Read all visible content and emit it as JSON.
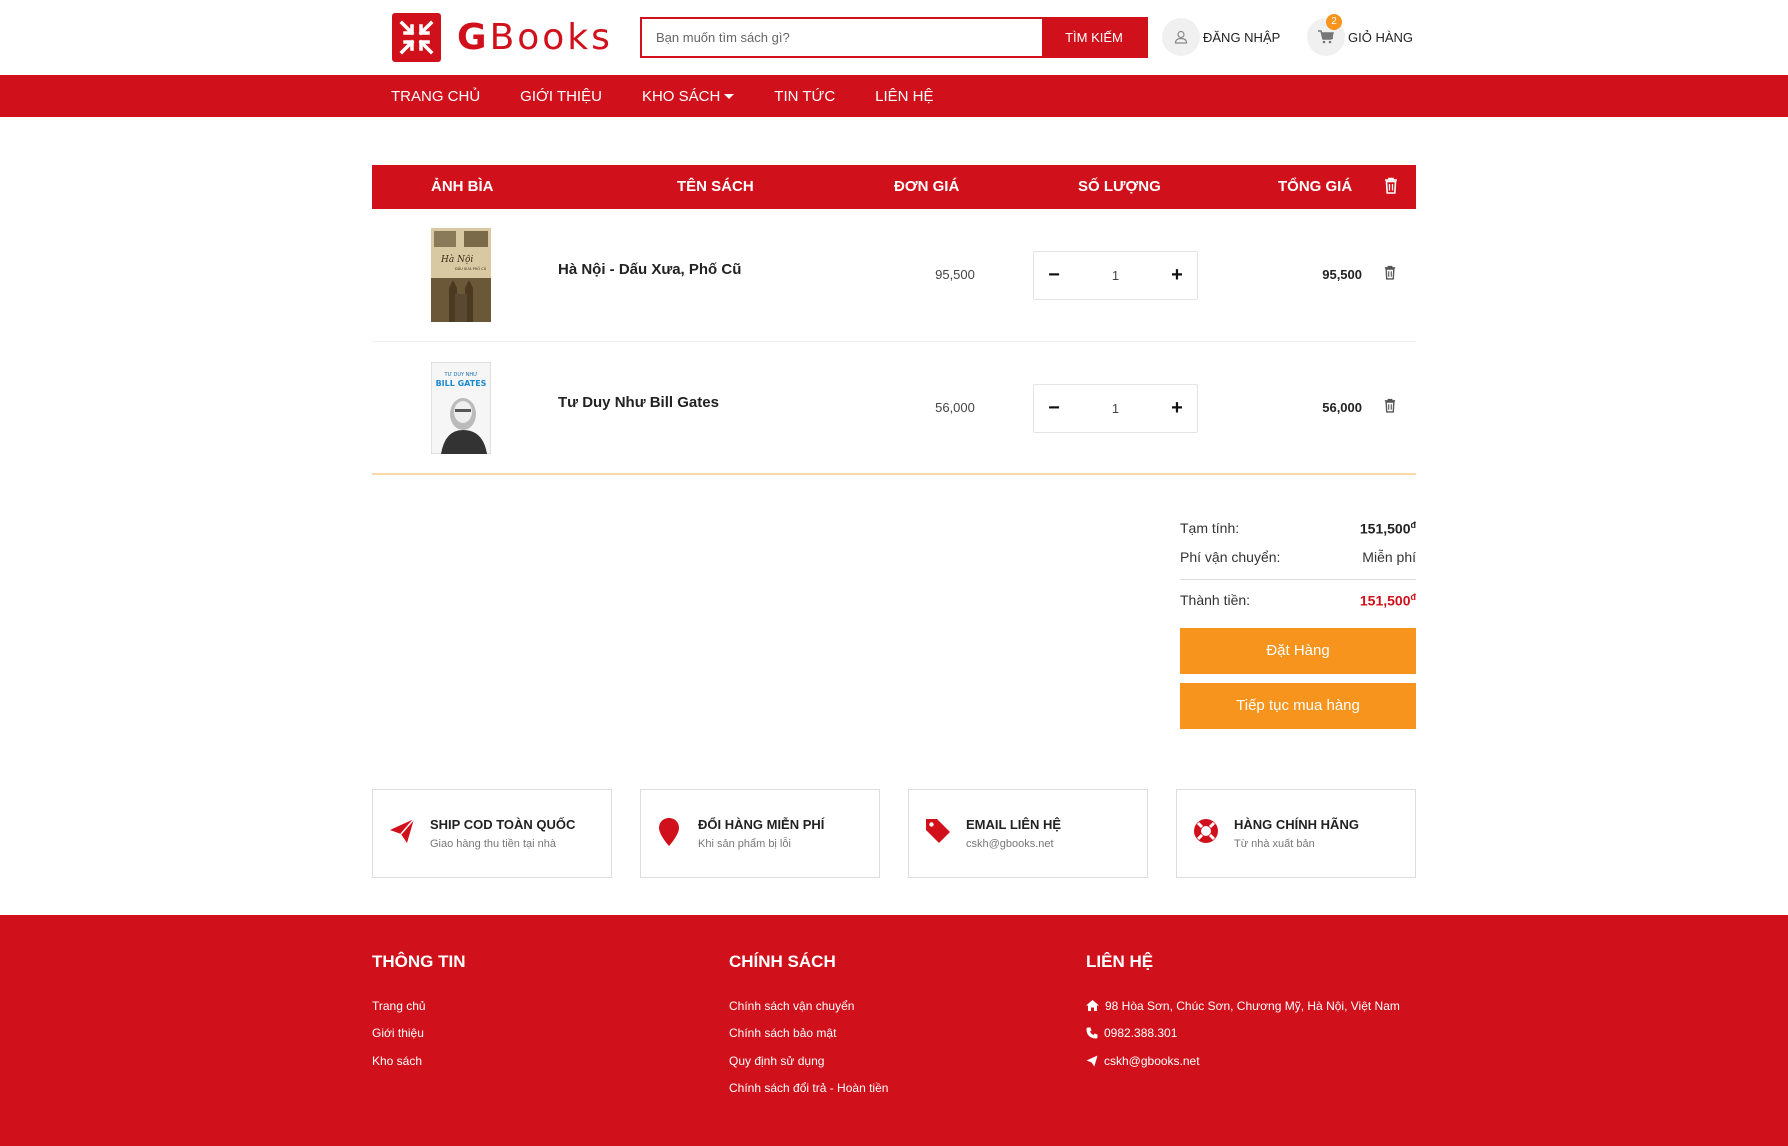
{
  "header": {
    "logo_initial": "G",
    "logo_rest": "Books",
    "search_placeholder": "Bạn muốn tìm sách gì?",
    "search_button": "TÌM KIẾM",
    "login_label": "ĐĂNG NHẬP",
    "cart_label": "GIỎ HÀNG",
    "cart_count": "2"
  },
  "nav": {
    "items": [
      "TRANG CHỦ",
      "GIỚI THIỆU",
      "KHO SÁCH",
      "TIN TỨC",
      "LIÊN HỆ"
    ]
  },
  "cart": {
    "headers": {
      "cover": "ẢNH BÌA",
      "name": "TÊN SÁCH",
      "price": "ĐƠN GIÁ",
      "qty": "SỐ LƯỢNG",
      "total": "TỔNG GIÁ"
    },
    "items": [
      {
        "name": "Hà Nội - Dấu Xưa, Phố Cũ",
        "price": "95,500",
        "qty": "1",
        "total": "95,500",
        "cover_title": "Hà Nội",
        "cover_sub": "DẤU XƯA PHỐ CŨ"
      },
      {
        "name": "Tư Duy Như Bill Gates",
        "price": "56,000",
        "qty": "1",
        "total": "56,000",
        "cover_title": "TƯ DUY NHƯ",
        "cover_sub": "BILL GATES"
      }
    ]
  },
  "summary": {
    "subtotal_label": "Tạm tính:",
    "subtotal_value": "151,500",
    "currency": "đ",
    "shipping_label": "Phí vận chuyển:",
    "shipping_value": "Miễn phí",
    "final_label": "Thành tiền:",
    "final_value": "151,500",
    "order_button": "Đặt Hàng",
    "continue_button": "Tiếp tục mua hàng"
  },
  "features": [
    {
      "title": "SHIP COD TOÀN QUỐC",
      "sub": "Giao hàng thu tiền tại nhà",
      "icon": "paper-plane-icon"
    },
    {
      "title": "ĐỔI HÀNG MIỄN PHÍ",
      "sub": "Khi sản phẩm bị lỗi",
      "icon": "map-marker-icon"
    },
    {
      "title": "EMAIL LIÊN HỆ",
      "sub": "cskh@gbooks.net",
      "icon": "tag-icon"
    },
    {
      "title": "HÀNG CHÍNH HÃNG",
      "sub": "Từ nhà xuất bản",
      "icon": "life-ring-icon"
    }
  ],
  "footer": {
    "info_title": "THÔNG TIN",
    "info_links": [
      "Trang chủ",
      "Giới thiệu",
      "Kho sách"
    ],
    "policy_title": "CHÍNH SÁCH",
    "policy_links": [
      "Chính sách vận chuyển",
      "Chính sách bảo mật",
      "Quy định sử dụng",
      "Chính sách đổi trả - Hoàn tiền"
    ],
    "contact_title": "LIÊN HỆ",
    "address": "98 Hòa Sơn, Chúc Sơn, Chương Mỹ, Hà Nội, Việt Nam",
    "phone": "0982.388.301",
    "email": "cskh@gbooks.net"
  },
  "colors": {
    "brand_red": "#d0111b",
    "accent_orange": "#f7941d"
  }
}
